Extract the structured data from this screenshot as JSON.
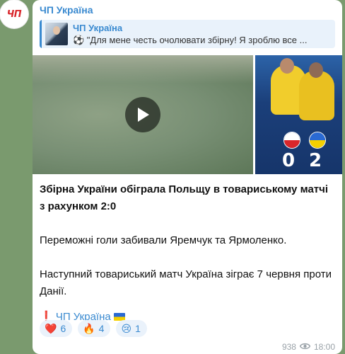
{
  "channel": {
    "name": "ЧП Україна",
    "avatar_text": "ЧП"
  },
  "reply": {
    "name": "ЧП Україна",
    "text": "⚽ \"Для мене честь очолювати збірну! Я зроблю все ..."
  },
  "media": {
    "video_icon": "play-icon",
    "photo_score_left": "0",
    "photo_score_right": "2"
  },
  "message": {
    "headline": "Збірна України обіграла Польщу в товариському матчі з рахунком 2:0",
    "paragraph1": "Переможні голи забивали Яремчук та Ярмоленко.",
    "paragraph2": "Наступний товариський матч Україна зіграє 7 червня проти Данії.",
    "footer_mark": "❗",
    "footer_link": "ЧП Україна"
  },
  "reactions": [
    {
      "emoji": "❤️",
      "count": "6"
    },
    {
      "emoji": "🔥",
      "count": "4"
    },
    {
      "emoji": "😢",
      "count": "1"
    }
  ],
  "meta": {
    "views": "938",
    "time": "18:00"
  },
  "colors": {
    "accent": "#3a8ad0",
    "reaction_bg": "#eaf2fb",
    "background": "#7a9a6e"
  }
}
